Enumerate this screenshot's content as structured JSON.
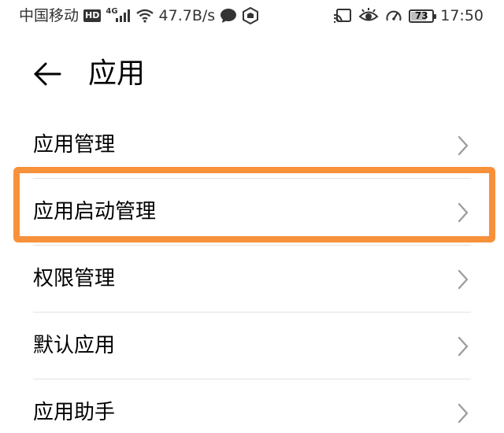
{
  "status_bar": {
    "carrier": "中国移动",
    "hd_badge": "HD",
    "network_type": "4G",
    "speed": "47.7B/s",
    "battery_level": "73",
    "battery_fraction": 0.73,
    "time": "17:50",
    "icons": [
      "hd-icon",
      "signal-icon",
      "wifi-icon",
      "chat-bubble-icon",
      "shield-app-icon",
      "cast-icon",
      "eye-comfort-icon",
      "speedometer-icon",
      "battery-icon"
    ]
  },
  "header": {
    "title": "应用",
    "back_icon": "back-arrow-icon"
  },
  "menu": {
    "items": [
      {
        "label": "应用管理"
      },
      {
        "label": "应用启动管理"
      },
      {
        "label": "权限管理"
      },
      {
        "label": "默认应用"
      },
      {
        "label": "应用助手"
      }
    ],
    "chevron_icon": "chevron-right-icon"
  },
  "highlight": {
    "color": "#f7913a",
    "target": "应用启动管理"
  }
}
